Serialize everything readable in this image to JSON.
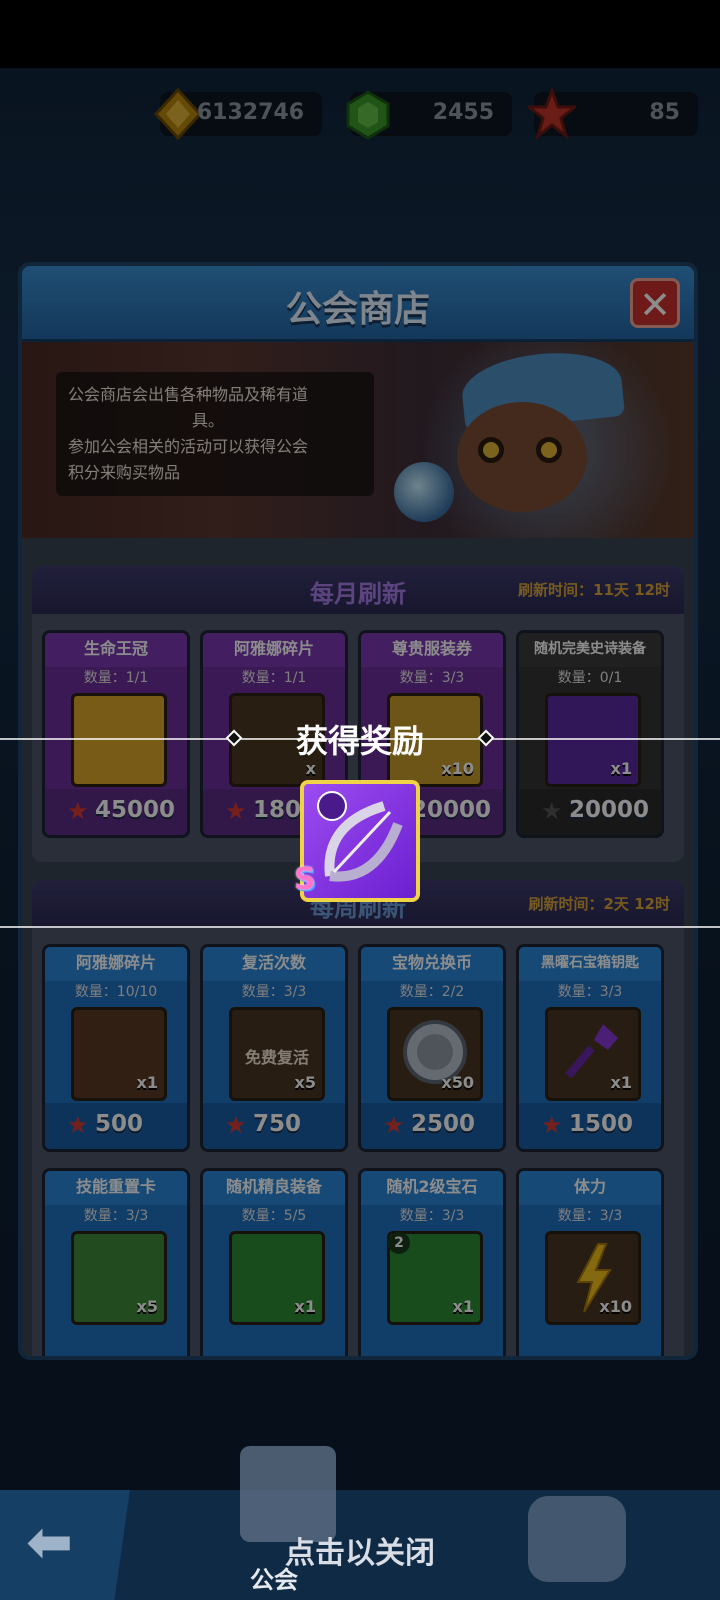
{
  "currency": {
    "gold": "6132746",
    "gems": "2455",
    "stars": "85"
  },
  "shop": {
    "title": "公会商店",
    "description_line1": "公会商店会出售各种物品及稀有道",
    "description_line2": "具。",
    "description_line3": "参加公会相关的活动可以获得公会",
    "description_line4": "积分来购买物品",
    "monthly": {
      "title": "每月刷新",
      "refresh": "刷新时间：11天 12时",
      "items": [
        {
          "name": "生命王冠",
          "qty": "数量：1/1",
          "mult": "",
          "price": "45000"
        },
        {
          "name": "阿雅娜碎片",
          "qty": "数量：1/1",
          "mult": "x",
          "price": "180"
        },
        {
          "name": "尊贵服装券",
          "qty": "数量：3/3",
          "mult": "x10",
          "price": "20000"
        },
        {
          "name": "随机完美史诗装备",
          "qty": "数量：0/1",
          "mult": "x1",
          "price": "20000"
        }
      ]
    },
    "weekly": {
      "title": "每周刷新",
      "refresh": "刷新时间：2天 12时",
      "items": [
        {
          "name": "阿雅娜碎片",
          "qty": "数量：10/10",
          "mult": "x1",
          "price": "500",
          "inner": ""
        },
        {
          "name": "复活次数",
          "qty": "数量：3/3",
          "mult": "x5",
          "price": "750",
          "inner": "免费复活"
        },
        {
          "name": "宝物兑换币",
          "qty": "数量：2/2",
          "mult": "x50",
          "price": "2500",
          "inner": ""
        },
        {
          "name": "黑曜石宝箱钥匙",
          "qty": "数量：3/3",
          "mult": "x1",
          "price": "1500",
          "inner": ""
        },
        {
          "name": "技能重置卡",
          "qty": "数量：3/3",
          "mult": "x5",
          "price": "",
          "inner": ""
        },
        {
          "name": "随机精良装备",
          "qty": "数量：5/5",
          "mult": "x1",
          "price": "",
          "inner": ""
        },
        {
          "name": "随机2级宝石",
          "qty": "数量：3/3",
          "mult": "x1",
          "price": "",
          "inner": "",
          "badge": "2"
        },
        {
          "name": "体力",
          "qty": "数量：3/3",
          "mult": "x10",
          "price": "",
          "inner": ""
        }
      ]
    }
  },
  "reward": {
    "title": "获得奖励",
    "grade": "S"
  },
  "bottom": {
    "tap_to_close": "点击以关闭",
    "guild_label": "公会"
  },
  "colors": {
    "monthly_accent": "#7b3ab2",
    "weekly_accent": "#2a86d8",
    "price_star": "#d53b32",
    "reward_border": "#f1d347"
  }
}
